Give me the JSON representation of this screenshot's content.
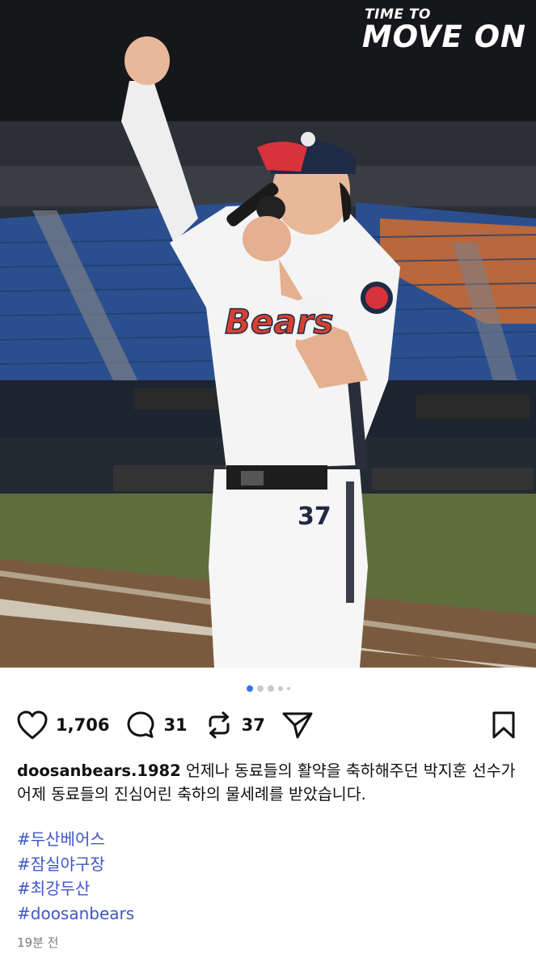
{
  "post": {
    "overlay": {
      "line1": "TIME TO",
      "line2": "MOVE ON"
    },
    "photo": {
      "jersey_text": "Bears",
      "jersey_number": "37"
    },
    "carousel": {
      "total": 5,
      "current": 1
    },
    "actions": {
      "likes": "1,706",
      "comments": "31",
      "reposts": "37"
    },
    "caption": {
      "username": "doosanbears.1982",
      "text": " 언제나 동료들의 활약을 축하해주던 박지훈 선수가 어제 동료들의 진심어린 축하의 물세례를 받았습니다."
    },
    "hashtags": [
      "#두산베어스",
      "#잠실야구장",
      "#최강두산",
      "#doosanbears"
    ],
    "timestamp": "19분 전"
  },
  "colors": {
    "hashtag": "#3f56c8",
    "active_dot": "#3a72e8"
  }
}
